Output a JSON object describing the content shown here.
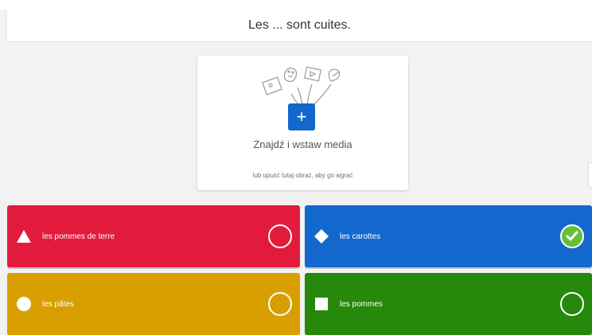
{
  "question": {
    "text": "Les ... sont cuites."
  },
  "media": {
    "title": "Znajdź i wstaw media",
    "subtitle": "lub upuść tutaj obraz, aby go wgrać",
    "add_icon": "plus-icon"
  },
  "answers": [
    {
      "shape": "triangle-icon",
      "text": "les pommes de terre",
      "correct": false,
      "color": "#e21b3c"
    },
    {
      "shape": "diamond-icon",
      "text": "les carottes",
      "correct": true,
      "color": "#1368ce"
    },
    {
      "shape": "circle-icon",
      "text": "les pâtes",
      "correct": false,
      "color": "#d89e00"
    },
    {
      "shape": "square-icon",
      "text": "les pommes",
      "correct": false,
      "color": "#26890c"
    }
  ],
  "colors": {
    "check_green": "#66bf39",
    "background": "#f2f2f2"
  }
}
